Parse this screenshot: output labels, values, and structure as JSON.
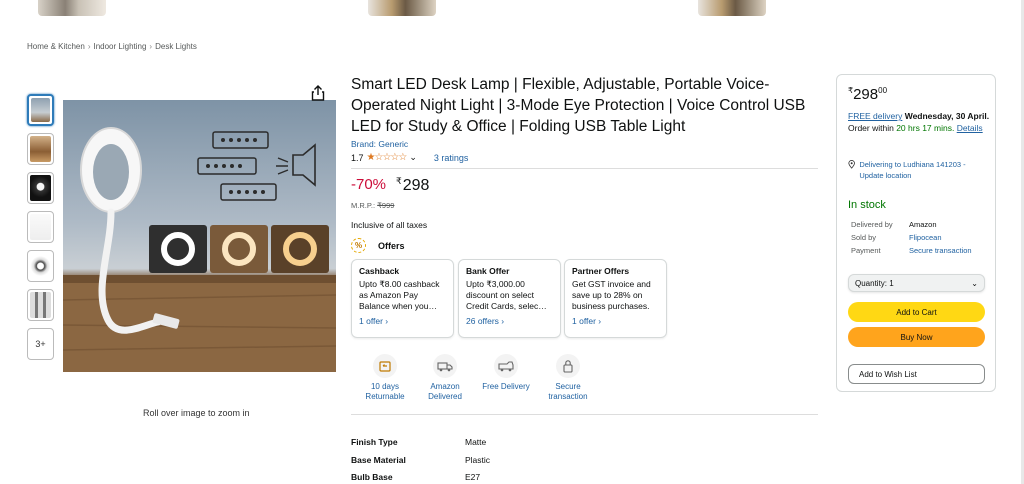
{
  "breadcrumb": [
    "Home & Kitchen",
    "Indoor Lighting",
    "Desk Lights"
  ],
  "product": {
    "title": "Smart LED Desk Lamp | Flexible, Adjustable, Portable Voice-Operated Night Light | 3-Mode Eye Protection | Voice Control USB LED for Study & Office | Folding USB Table Light",
    "brand": "Brand: Generic",
    "rating": "1.7",
    "stars_glyphs": "★☆☆☆☆",
    "ratings_count": "3 ratings",
    "discount": "-70%",
    "price_symbol": "₹",
    "price": "298",
    "mrp_label": "M.R.P.:",
    "mrp": "₹999",
    "tax_note": "Inclusive of all taxes",
    "zoom_hint": "Roll over image to zoom in",
    "more_images": "3+"
  },
  "offers": {
    "heading": "Offers",
    "icon": "%",
    "cards": [
      {
        "title": "Cashback",
        "body": "Upto ₹8.00 cashback as Amazon Pay Balance when you…",
        "link": "1 offer ›"
      },
      {
        "title": "Bank Offer",
        "body": "Upto ₹3,000.00 discount on select Credit Cards, selec…",
        "link": "26 offers ›"
      },
      {
        "title": "Partner Offers",
        "body": "Get GST invoice and save up to 28% on business purchases.",
        "link": "1 offer ›"
      }
    ]
  },
  "features": [
    {
      "icon": "return-box-icon",
      "label": "10 days Returnable"
    },
    {
      "icon": "truck-icon",
      "label": "Amazon Delivered"
    },
    {
      "icon": "van-icon",
      "label": "Free Delivery"
    },
    {
      "icon": "lock-icon",
      "label": "Secure transaction"
    }
  ],
  "specs": [
    {
      "key": "Finish Type",
      "value": "Matte"
    },
    {
      "key": "Base Material",
      "value": "Plastic"
    },
    {
      "key": "Bulb Base",
      "value": "E27"
    }
  ],
  "buybox": {
    "price_symbol": "₹",
    "price": "298",
    "price_fraction": "00",
    "free_delivery": "FREE delivery",
    "delivery_date": "Wednesday, 30 April.",
    "order_within_label": "Order within",
    "order_within_time": "20 hrs 17 mins.",
    "details_link": "Details",
    "location": "Delivering to Ludhiana 141203 - Update location",
    "stock": "In stock",
    "delivered_by_label": "Delivered by",
    "delivered_by": "Amazon",
    "sold_by_label": "Sold by",
    "sold_by": "Flipocean",
    "payment_label": "Payment",
    "payment": "Secure transaction",
    "quantity": "Quantity: 1",
    "add_to_cart": "Add to Cart",
    "buy_now": "Buy Now",
    "wish_list": "Add to Wish List"
  },
  "colors": {
    "link": "#2162a1",
    "discount": "#cc0c39",
    "in_stock": "#007600",
    "cart_button": "#ffd814",
    "buy_button": "#ffa41c"
  }
}
